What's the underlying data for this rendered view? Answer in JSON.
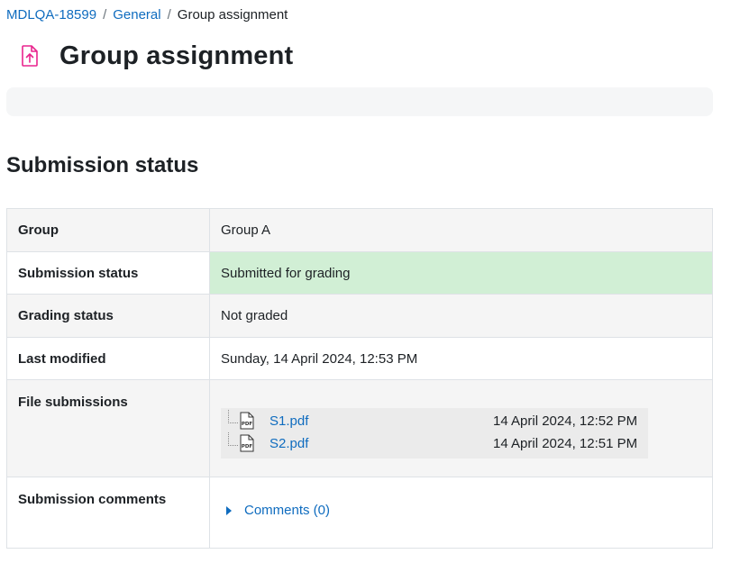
{
  "breadcrumb": {
    "items": [
      {
        "label": "MDLQA-18599"
      },
      {
        "label": "General"
      }
    ],
    "separator": "/",
    "current": "Group assignment"
  },
  "page": {
    "title": "Group assignment",
    "icon": "assign-upload-icon"
  },
  "section": {
    "heading": "Submission status"
  },
  "status_table": {
    "group": {
      "label": "Group",
      "value": "Group A"
    },
    "submission_status": {
      "label": "Submission status",
      "value": "Submitted for grading"
    },
    "grading_status": {
      "label": "Grading status",
      "value": "Not graded"
    },
    "last_modified": {
      "label": "Last modified",
      "value": "Sunday, 14 April 2024, 12:53 PM"
    },
    "file_submissions": {
      "label": "File submissions",
      "files": [
        {
          "name": "S1.pdf",
          "date": "14 April 2024, 12:52 PM",
          "icon": "pdf-icon"
        },
        {
          "name": "S2.pdf",
          "date": "14 April 2024, 12:51 PM",
          "icon": "pdf-icon"
        }
      ]
    },
    "submission_comments": {
      "label": "Submission comments",
      "link": "Comments (0)"
    }
  },
  "colors": {
    "link": "#0f6cbf",
    "icon_accent": "#e9248d",
    "success_bg": "#d1efd5"
  }
}
